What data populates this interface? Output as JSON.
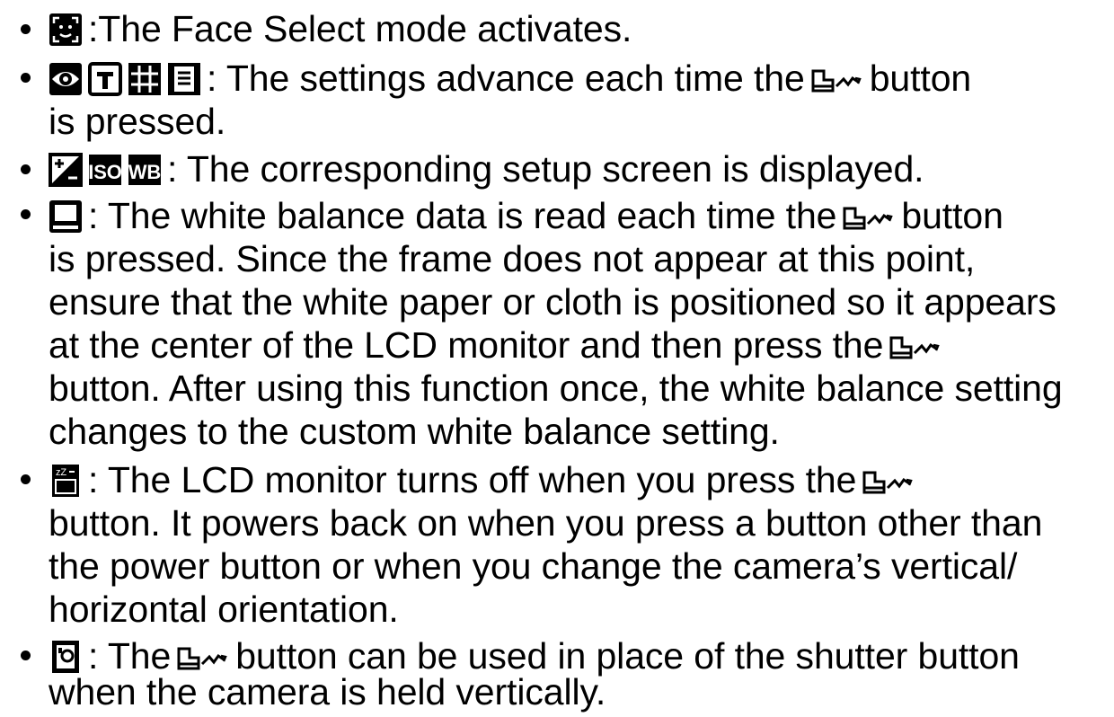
{
  "items": [
    {
      "icons": [
        "face-select-icon"
      ],
      "lines": [
        ":The Face Select mode activates."
      ]
    },
    {
      "icons": [
        "eye-icon",
        "t-box-icon",
        "grid-icon",
        "overlay-icon"
      ],
      "lines": [
        ": The settings advance each time the",
        "button",
        "is pressed."
      ]
    },
    {
      "icons": [
        "exposure-compensation-icon",
        "iso-icon",
        "white-balance-icon"
      ],
      "lines": [
        ": The corresponding setup screen is displayed."
      ]
    },
    {
      "icons": [
        "custom-wb-icon"
      ],
      "lines": [
        ": The white balance data is read each time the",
        "button",
        "is pressed. Since the frame does not appear at this point,",
        "ensure that the white paper or cloth is positioned so it appears",
        "at the center of the LCD monitor and then press the",
        "button. After using this function once, the white balance setting",
        "changes to the custom white balance setting."
      ]
    },
    {
      "icons": [
        "lcd-off-icon"
      ],
      "lines": [
        ": The LCD monitor turns off when you press the",
        "button. It powers back on when you press a button other than",
        "the power button or when you change the camera’s vertical/",
        "horizontal orientation."
      ]
    },
    {
      "icons": [
        "vertical-shutter-icon"
      ],
      "lines": [
        ": The",
        "button can be used in place of the shutter button",
        "when the camera is held vertically."
      ]
    }
  ]
}
